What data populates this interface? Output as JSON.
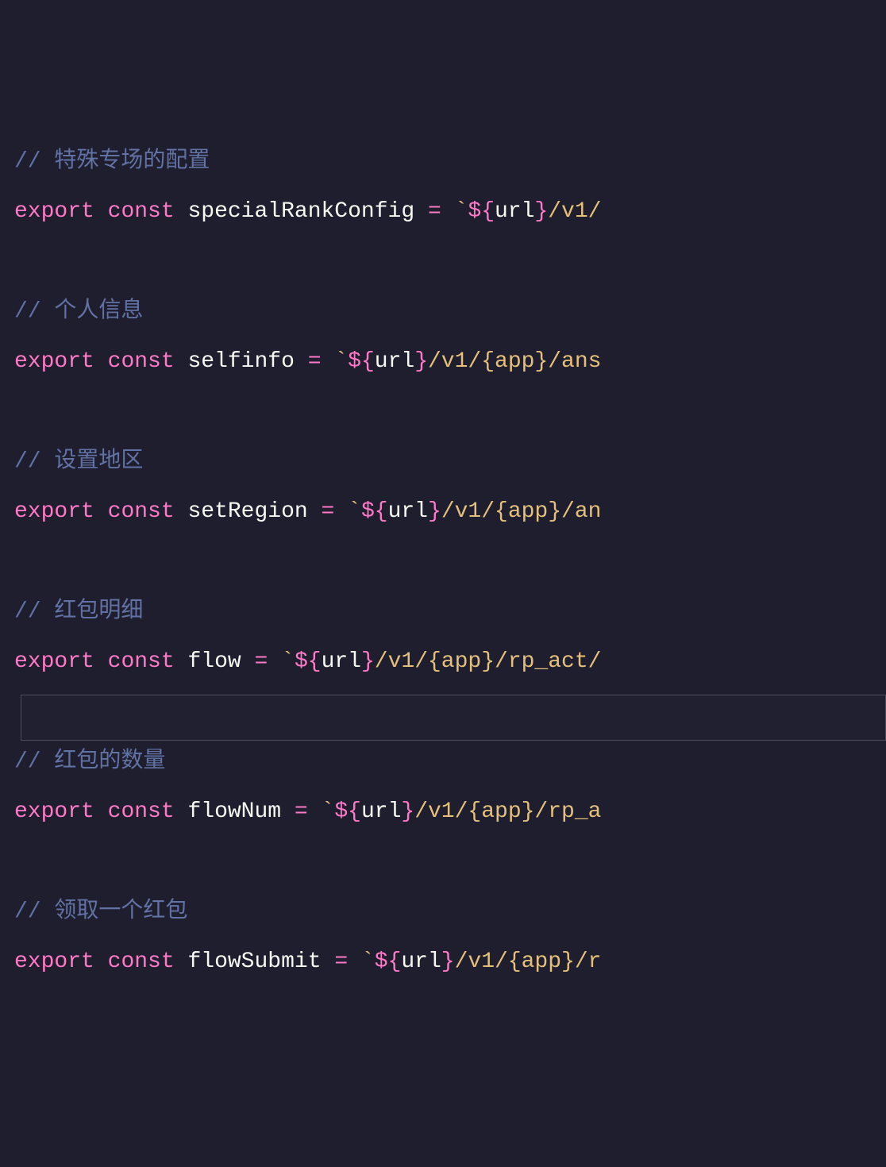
{
  "code": {
    "lines": [
      {
        "type": "comment",
        "text": "// 特殊专场的配置"
      },
      {
        "type": "decl",
        "keyword1": "export",
        "keyword2": "const",
        "name": "specialRankConfig",
        "op": "=",
        "tpl_prefix": "`",
        "dollar": "$",
        "brace_open": "{",
        "var": "url",
        "brace_close": "}",
        "path": "/v1/"
      },
      {
        "type": "blank"
      },
      {
        "type": "comment",
        "text": "// 个人信息"
      },
      {
        "type": "decl",
        "keyword1": "export",
        "keyword2": "const",
        "name": "selfinfo",
        "op": "=",
        "tpl_prefix": "`",
        "dollar": "$",
        "brace_open": "{",
        "var": "url",
        "brace_close": "}",
        "path": "/v1/{app}/ans"
      },
      {
        "type": "blank"
      },
      {
        "type": "comment",
        "text": "// 设置地区"
      },
      {
        "type": "decl",
        "keyword1": "export",
        "keyword2": "const",
        "name": "setRegion",
        "op": "=",
        "tpl_prefix": "`",
        "dollar": "$",
        "brace_open": "{",
        "var": "url",
        "brace_close": "}",
        "path": "/v1/{app}/an"
      },
      {
        "type": "blank"
      },
      {
        "type": "comment",
        "text": "// 红包明细"
      },
      {
        "type": "decl",
        "keyword1": "export",
        "keyword2": "const",
        "name": "flow",
        "op": "=",
        "tpl_prefix": "`",
        "dollar": "$",
        "brace_open": "{",
        "var": "url",
        "brace_close": "}",
        "path": "/v1/{app}/rp_act/"
      },
      {
        "type": "cursor"
      },
      {
        "type": "comment",
        "text": "// 红包的数量"
      },
      {
        "type": "decl",
        "keyword1": "export",
        "keyword2": "const",
        "name": "flowNum",
        "op": "=",
        "tpl_prefix": "`",
        "dollar": "$",
        "brace_open": "{",
        "var": "url",
        "brace_close": "}",
        "path": "/v1/{app}/rp_a"
      },
      {
        "type": "blank"
      },
      {
        "type": "comment",
        "text": "// 领取一个红包"
      },
      {
        "type": "decl",
        "keyword1": "export",
        "keyword2": "const",
        "name": "flowSubmit",
        "op": "=",
        "tpl_prefix": "`",
        "dollar": "$",
        "brace_open": "{",
        "var": "url",
        "brace_close": "}",
        "path": "/v1/{app}/r"
      }
    ]
  },
  "colors": {
    "background": "#1e1e2e",
    "comment": "#6272a4",
    "keyword": "#ff79c6",
    "identifier": "#f8f8f2",
    "string": "#e5c07b"
  }
}
